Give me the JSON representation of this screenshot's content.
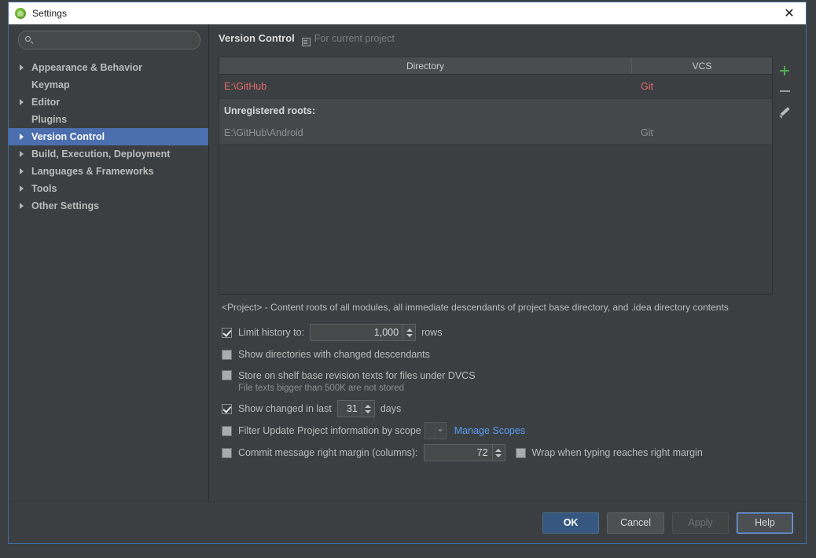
{
  "window": {
    "title": "Settings",
    "app_icon": "android-studio-icon",
    "close_icon": "close-icon",
    "border_color": "#3b6ea5"
  },
  "sidebar": {
    "search": {
      "value": "",
      "placeholder": "",
      "icon": "search-icon"
    },
    "items": [
      {
        "label": "Appearance & Behavior",
        "expandable": true,
        "selected": false
      },
      {
        "label": "Keymap",
        "expandable": false,
        "selected": false
      },
      {
        "label": "Editor",
        "expandable": true,
        "selected": false
      },
      {
        "label": "Plugins",
        "expandable": false,
        "selected": false
      },
      {
        "label": "Version Control",
        "expandable": true,
        "selected": true
      },
      {
        "label": "Build, Execution, Deployment",
        "expandable": true,
        "selected": false
      },
      {
        "label": "Languages & Frameworks",
        "expandable": true,
        "selected": false
      },
      {
        "label": "Tools",
        "expandable": true,
        "selected": false
      },
      {
        "label": "Other Settings",
        "expandable": true,
        "selected": false
      }
    ],
    "selection_color": "#4b6eaf"
  },
  "content": {
    "header": {
      "title": "Version Control",
      "scope_icon": "project-scope-icon",
      "scope_label": "For current project"
    },
    "table": {
      "columns": [
        "Directory",
        "VCS"
      ],
      "rows": [
        {
          "directory": "E:\\GitHub",
          "vcs": "Git",
          "style": "registered"
        },
        {
          "directory": "Unregistered roots:",
          "vcs": "",
          "style": "group"
        },
        {
          "directory": "E:\\GitHub\\Android",
          "vcs": "Git",
          "style": "unregistered"
        }
      ],
      "registered_color": "#e06c6c",
      "unregistered_color": "#8f9294"
    },
    "toolbar": {
      "add": {
        "icon": "plus-icon",
        "color": "#4fae4f"
      },
      "remove": {
        "icon": "minus-icon",
        "color": "#9a9d9e"
      },
      "edit": {
        "icon": "pencil-icon",
        "color": "#b7babb"
      }
    },
    "project_note": "<Project> - Content roots of all modules, all immediate descendants of project base directory, and .idea directory contents",
    "options": {
      "limit_history": {
        "checked": true,
        "label": "Limit history to:",
        "value": "1,000",
        "suffix": "rows"
      },
      "show_directories": {
        "checked": false,
        "label": "Show directories with changed descendants"
      },
      "store_on_shelf": {
        "checked": false,
        "label": "Store on shelf base revision texts for files under DVCS",
        "note": "File texts bigger than 500K are not stored"
      },
      "show_changed_in_last": {
        "checked": true,
        "label": "Show changed in last",
        "value": "31",
        "suffix": "days"
      },
      "filter_by_scope": {
        "checked": false,
        "label": "Filter Update Project information by scope",
        "combo_value": "",
        "link": "Manage Scopes"
      },
      "commit_margin": {
        "checked": false,
        "label": "Commit message right margin (columns):",
        "value": "72"
      },
      "wrap_when_typing": {
        "checked": false,
        "label": "Wrap when typing reaches right margin"
      }
    }
  },
  "footer": {
    "ok": "OK",
    "cancel": "Cancel",
    "apply": "Apply",
    "help": "Help"
  }
}
